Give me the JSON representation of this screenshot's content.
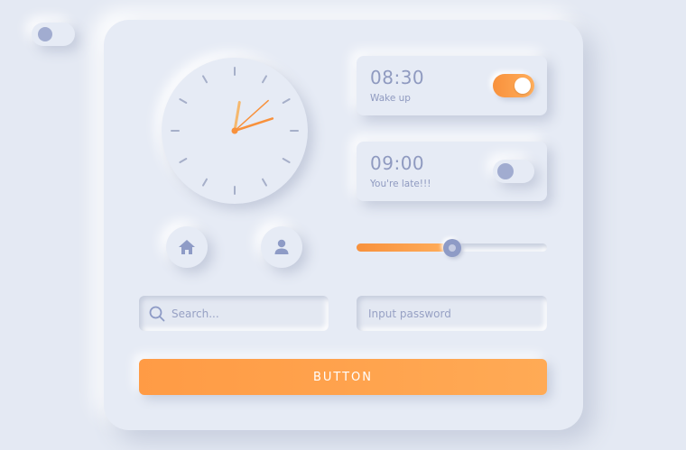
{
  "theme_toggle": {
    "state": "off"
  },
  "clock": {
    "hour": 12,
    "minute": 7,
    "second": 8,
    "accent": "#f8913c"
  },
  "alarms": [
    {
      "time": "08:30",
      "label": "Wake up",
      "enabled": true
    },
    {
      "time": "09:00",
      "label": "You're late!!!",
      "enabled": false
    }
  ],
  "icons": {
    "home": "home-icon",
    "user": "user-icon",
    "search": "search-icon"
  },
  "slider": {
    "value_percent": 50
  },
  "search": {
    "placeholder": "Search..."
  },
  "password": {
    "placeholder": "Input password"
  },
  "button": {
    "label": "BUTTON"
  },
  "colors": {
    "accent": "#f8913c",
    "muted": "#8f9ac0",
    "background": "#e4e9f3"
  }
}
